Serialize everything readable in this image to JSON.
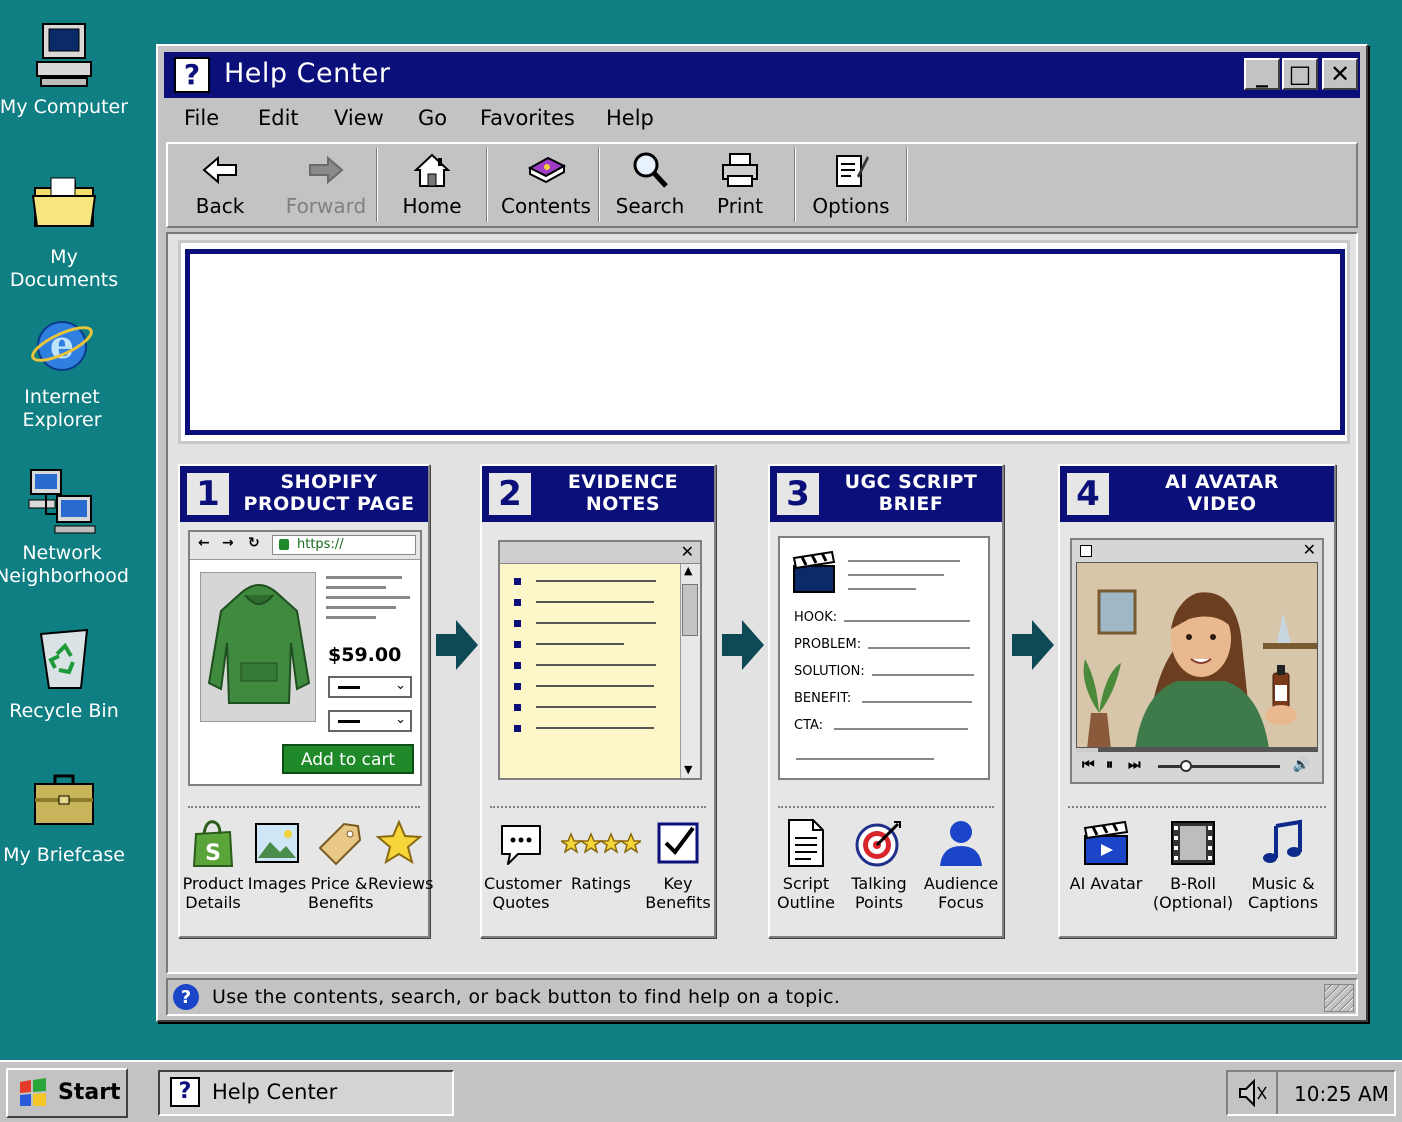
{
  "desktop": {
    "icons": [
      {
        "label": "My Computer"
      },
      {
        "label": "My Documents"
      },
      {
        "label": "Internet Explorer",
        "line1": "Internet",
        "line2": "Explorer"
      },
      {
        "label": "Network Neighborhood",
        "line1": "Network",
        "line2": "Neighborhood"
      },
      {
        "label": "Recycle Bin"
      },
      {
        "label": "My Briefcase"
      }
    ]
  },
  "window": {
    "title": "Help Center",
    "icon": "question-icon",
    "controls": {
      "minimize": "_",
      "maximize": "□",
      "close": "✕"
    }
  },
  "menu": [
    "File",
    "Edit",
    "View",
    "Go",
    "Favorites",
    "Help"
  ],
  "toolbar": {
    "back": "Back",
    "forward": "Forward",
    "home": "Home",
    "contents": "Contents",
    "search": "Search",
    "print": "Print",
    "options": "Options"
  },
  "steps": [
    {
      "num": "1",
      "title1": "SHOPIFY",
      "title2": "PRODUCT PAGE",
      "browser": {
        "url": "https://",
        "price": "$59.00",
        "cta": "Add to cart"
      },
      "features": [
        {
          "l1": "Product",
          "l2": "Details",
          "icon": "shopify-bag-icon"
        },
        {
          "l1": "Images",
          "l2": "",
          "icon": "image-icon"
        },
        {
          "l1": "Price &",
          "l2": "Benefits",
          "icon": "price-tag-icon"
        },
        {
          "l1": "Reviews",
          "l2": "",
          "icon": "star-icon"
        }
      ]
    },
    {
      "num": "2",
      "title1": "EVIDENCE",
      "title2": "NOTES",
      "features": [
        {
          "l1": "Customer",
          "l2": "Quotes",
          "icon": "speech-bubble-icon"
        },
        {
          "l1": "Ratings",
          "l2": "",
          "icon": "stars-rating-icon"
        },
        {
          "l1": "Key",
          "l2": "Benefits",
          "icon": "checkbox-icon"
        }
      ]
    },
    {
      "num": "3",
      "title1": "UGC SCRIPT",
      "title2": "BRIEF",
      "script": {
        "hook": "HOOK:",
        "problem": "PROBLEM:",
        "solution": "SOLUTION:",
        "benefit": "BENEFIT:",
        "cta": "CTA:"
      },
      "features": [
        {
          "l1": "Script",
          "l2": "Outline",
          "icon": "document-icon"
        },
        {
          "l1": "Talking",
          "l2": "Points",
          "icon": "target-icon"
        },
        {
          "l1": "Audience",
          "l2": "Focus",
          "icon": "person-icon"
        }
      ]
    },
    {
      "num": "4",
      "title1": "AI AVATAR",
      "title2": "VIDEO",
      "features": [
        {
          "l1": "AI Avatar",
          "l2": "",
          "icon": "clapperboard-icon"
        },
        {
          "l1": "B-Roll",
          "l2": "(Optional)",
          "icon": "film-strip-icon"
        },
        {
          "l1": "Music &",
          "l2": "Captions",
          "icon": "music-note-icon"
        }
      ]
    }
  ],
  "status": {
    "text": "Use the contents, search, or back button to find help on a topic."
  },
  "taskbar": {
    "start": "Start",
    "task": "Help Center",
    "clock": "10:25 AM"
  },
  "colors": {
    "desktop": "#0f7f83",
    "titlebar": "#0b0f7a",
    "face": "#c3c3c3",
    "cart_button": "#1f8a2a",
    "arrow": "#0d4a55"
  }
}
